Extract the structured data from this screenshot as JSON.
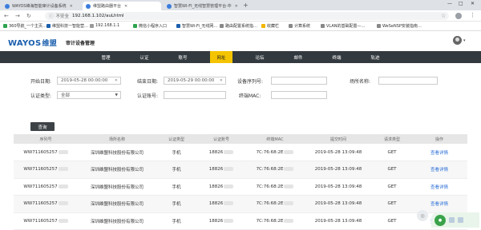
{
  "browser": {
    "tabs": [
      {
        "label": "WAYOS峰海智能审计设备系统"
      },
      {
        "label": "维盟路由器平台"
      },
      {
        "label": "智慧WI-FI_无线智慧管理平台·中"
      }
    ],
    "address": {
      "insecure_label": "不安全",
      "url": "192.168.1.102/auLhtml"
    },
    "bookmarks": [
      {
        "label": "360导航_一个主页…",
        "color": "#2ea44f"
      },
      {
        "label": "维盟科技一智能营…",
        "color": "#1b5fad"
      },
      {
        "label": "192.168.1.1",
        "color": "#999999"
      },
      {
        "label": "微信小程序入口",
        "color": "#2ea44f"
      },
      {
        "label": "智慧Wi-Fi_无线网…",
        "color": "#1b5fad"
      },
      {
        "label": "路由配置系统指…",
        "color": "#888888"
      },
      {
        "label": "收藏栏",
        "color": "#f2b600"
      },
      {
        "label": "计算系统",
        "color": "#888888"
      },
      {
        "label": "VLAN的基础配置—…",
        "color": "#888888"
      },
      {
        "label": "WeSeNSP安装指南…",
        "color": "#888888"
      }
    ]
  },
  "header": {
    "logo_en": "WAYOS",
    "logo_cn": "维盟",
    "subtitle": "审计设备管理"
  },
  "nav": {
    "items": [
      {
        "label": "管理"
      },
      {
        "label": "认证"
      },
      {
        "label": "账号"
      },
      {
        "label": "网址"
      },
      {
        "label": "论坛"
      },
      {
        "label": "邮件"
      },
      {
        "label": "终端"
      },
      {
        "label": "轨迹"
      }
    ],
    "active_index": 3
  },
  "form": {
    "start_label": "开始日期:",
    "start_value": "2019-05-28 00:00:00",
    "end_label": "结束日期:",
    "end_value": "2019-05-29 00:00:00",
    "serial_label": "设备序列号:",
    "serial_value": "",
    "place_label": "场所名称:",
    "place_value": "",
    "auth_type_label": "认证类型:",
    "auth_type_value": "全部",
    "auth_account_label": "认证账号:",
    "auth_account_value": "",
    "mac_label": "终端MAC:",
    "mac_value": "",
    "search_button": "查询"
  },
  "table": {
    "headers": [
      "序列号",
      "场所名称",
      "认证类型",
      "认证账号",
      "终端MAC",
      "提交时间",
      "请求类型",
      "操作"
    ],
    "rows": [
      {
        "serial": "WW711605257",
        "place": "深圳维盟科技股份有限公司",
        "type": "手机",
        "account": "18826",
        "mac": "7C:76:68:2E",
        "time": "2019-05-28 13:09:48",
        "method": "GET",
        "op": "查看详情"
      },
      {
        "serial": "WW711605257",
        "place": "深圳维盟科技股份有限公司",
        "type": "手机",
        "account": "18826",
        "mac": "7C:76:68:2E",
        "time": "2019-05-28 13:09:48",
        "method": "GET",
        "op": "查看详情"
      },
      {
        "serial": "WW711605257",
        "place": "深圳维盟科技股份有限公司",
        "type": "手机",
        "account": "18826",
        "mac": "7C:76:68:2E",
        "time": "2019-05-28 13:09:48",
        "method": "GET",
        "op": "查看详情"
      },
      {
        "serial": "WW711605257",
        "place": "深圳维盟科技股份有限公司",
        "type": "手机",
        "account": "18826",
        "mac": "7C:76:68:2E",
        "time": "2019-05-28 13:09:48",
        "method": "GET",
        "op": "查看详情"
      },
      {
        "serial": "WW711605257",
        "place": "深圳维盟科技股份有限公司",
        "type": "手机",
        "account": "18826",
        "mac": "7C:76:68:2E",
        "time": "2019-05-28 13:09:48",
        "method": "GET",
        "op": "查看详情"
      }
    ]
  },
  "colors": {
    "accent": "#f5c400",
    "nav_bg": "#333a3f",
    "link": "#2a6fd6",
    "logo": "#1b5fad"
  }
}
